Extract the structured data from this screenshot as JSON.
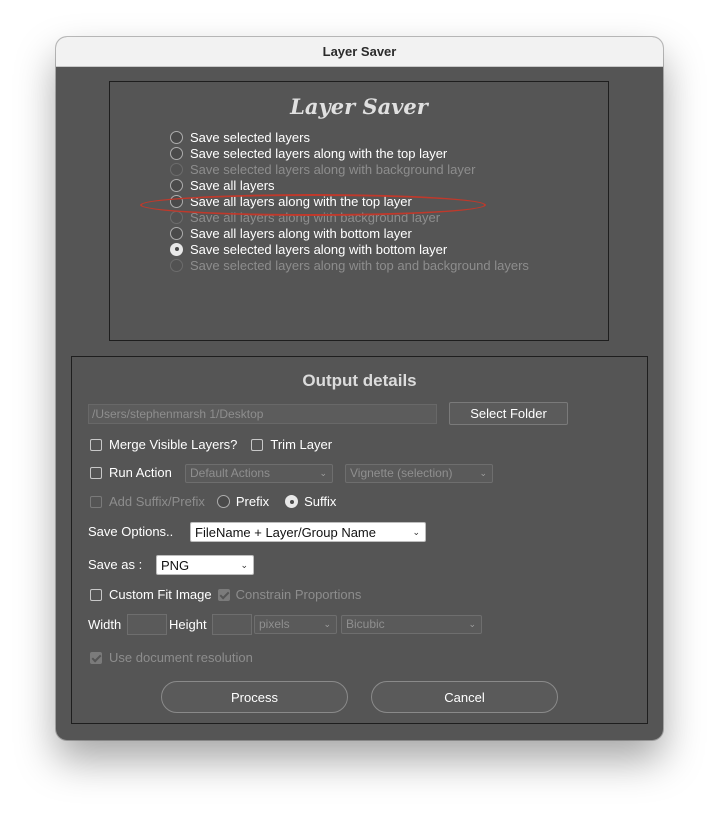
{
  "window": {
    "title": "Layer Saver"
  },
  "panel1": {
    "title": "Layer Saver",
    "options": [
      {
        "label": "Save selected layers",
        "enabled": true,
        "checked": false
      },
      {
        "label": "Save selected layers along with the top layer",
        "enabled": true,
        "checked": false
      },
      {
        "label": "Save selected layers along with background layer",
        "enabled": false,
        "checked": false
      },
      {
        "label": "Save all layers",
        "enabled": true,
        "checked": false
      },
      {
        "label": "Save all layers along with the top layer",
        "enabled": true,
        "checked": false
      },
      {
        "label": "Save all layers along with background layer",
        "enabled": false,
        "checked": false
      },
      {
        "label": "Save all layers along with bottom layer",
        "enabled": true,
        "checked": false
      },
      {
        "label": "Save selected layers along with bottom layer",
        "enabled": true,
        "checked": true
      },
      {
        "label": "Save selected layers along with top and background layers",
        "enabled": false,
        "checked": false
      }
    ],
    "highlight_color": "#c0392b"
  },
  "output": {
    "title": "Output details",
    "folder_path": "/Users/stephenmarsh 1/Desktop",
    "select_folder_label": "Select Folder",
    "merge_visible_label": "Merge Visible Layers?",
    "trim_layer_label": "Trim Layer",
    "run_action_label": "Run Action",
    "action_set_value": "Default Actions",
    "action_value": "Vignette (selection)",
    "add_suffix_label": "Add Suffix/Prefix",
    "prefix_label": "Prefix",
    "suffix_label": "Suffix",
    "save_options_label": "Save Options..",
    "save_options_value": "FileName + Layer/Group Name",
    "save_as_label": "Save as :",
    "save_as_value": "PNG",
    "custom_fit_label": "Custom Fit Image",
    "constrain_label": "Constrain Proportions",
    "width_label": "Width",
    "height_label": "Height",
    "units_value": "pixels",
    "resample_value": "Bicubic",
    "use_doc_res_label": "Use document resolution",
    "process_label": "Process",
    "cancel_label": "Cancel"
  },
  "colors": {
    "panel_bg": "#555555",
    "titlebar_bg": "#f2f2f2",
    "text": "#ffffff",
    "disabled_text": "#8d8d8d"
  }
}
